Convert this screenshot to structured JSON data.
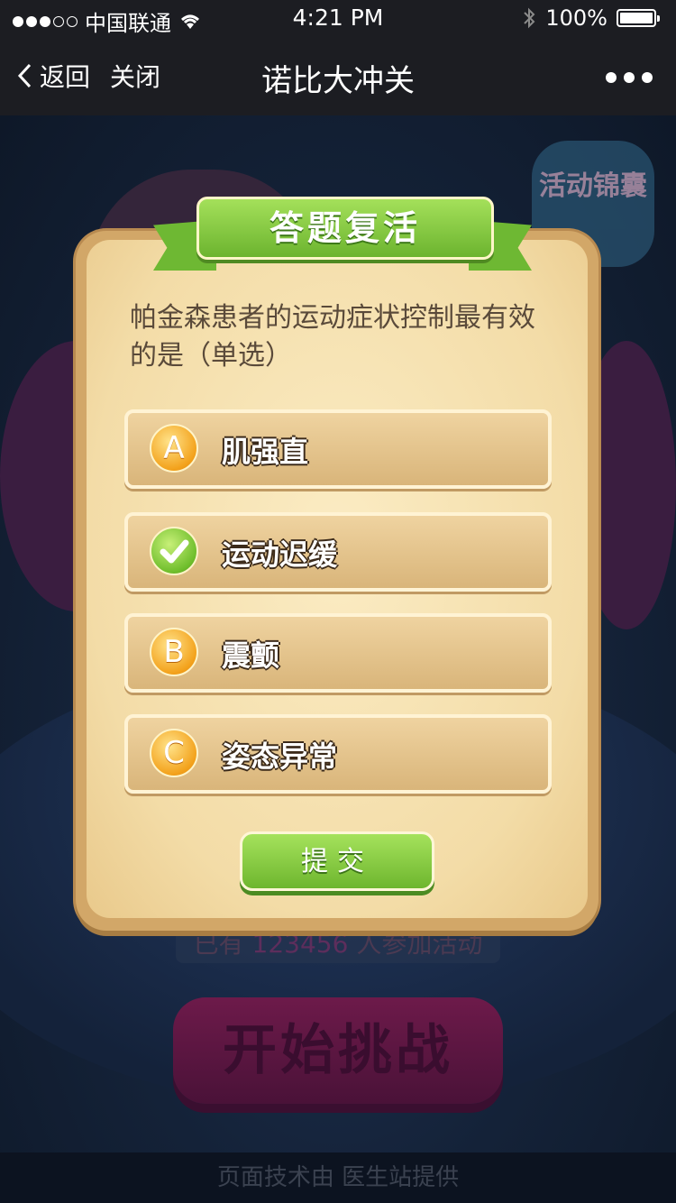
{
  "status_bar": {
    "carrier": "中国联通",
    "time": "4:21 PM",
    "battery_text": "100%",
    "battery_level": 1.0,
    "signal_filled": 3,
    "signal_total": 5
  },
  "nav": {
    "back_label": "返回",
    "close_label": "关闭",
    "title": "诺比大冲关"
  },
  "background": {
    "activity_badge": "活动锦囊",
    "participants_prefix": "已有",
    "participants_count": "123456",
    "participants_suffix": "人参加活动",
    "start_button": "开始挑战",
    "footer": "页面技术由 医生站提供"
  },
  "dialog": {
    "title": "答题复活",
    "question": "帕金森患者的运动症状控制最有效的是（单选）",
    "options": [
      {
        "badge": "A",
        "label": "肌强直",
        "selected": false
      },
      {
        "badge": "",
        "label": "运动迟缓",
        "selected": true
      },
      {
        "badge": "B",
        "label": "震颤",
        "selected": false
      },
      {
        "badge": "C",
        "label": "姿态异常",
        "selected": false
      }
    ],
    "submit_label": "提交"
  },
  "colors": {
    "nav_bg": "#1c1d22",
    "card_bg": "#f3dca7",
    "ribbon_green": "#6cb42f",
    "badge_orange": "#f3a21c",
    "check_green": "#6fbe2c"
  }
}
